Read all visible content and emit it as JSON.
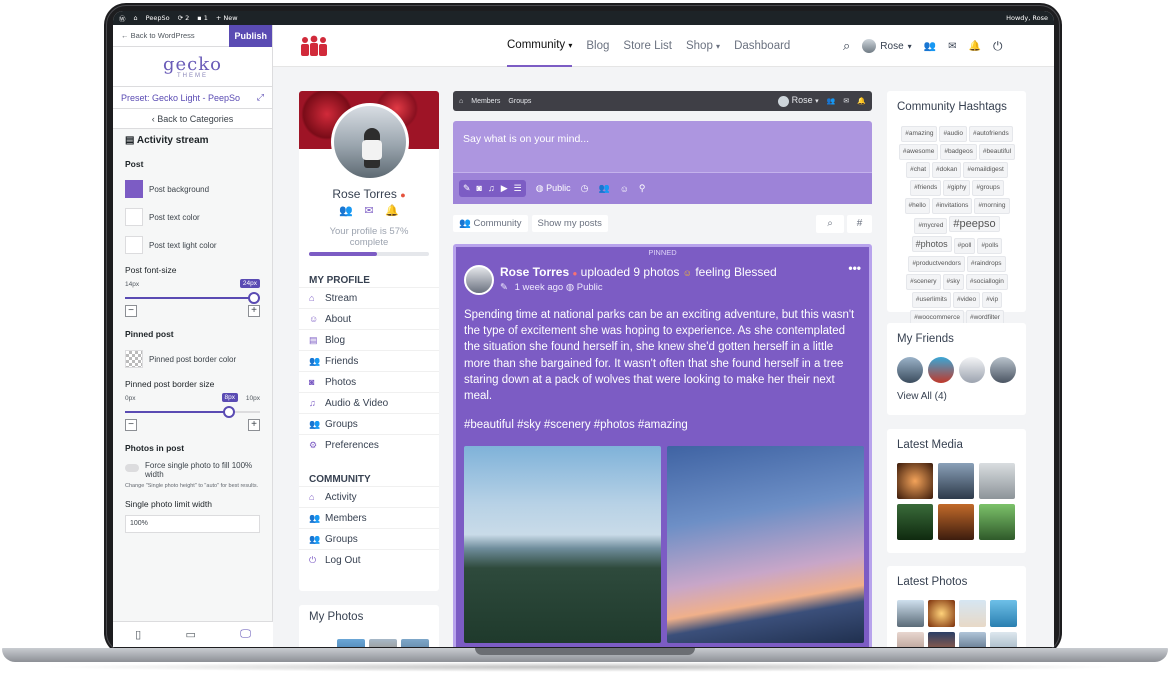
{
  "admin_bar": {
    "site": "PeepSo",
    "updates": "2",
    "comments": "1",
    "new": "New",
    "howdy": "Howdy, Rose"
  },
  "customizer": {
    "back": "Back to WordPress",
    "publish": "Publish",
    "logo_main": "gecko",
    "logo_sub": "THEME",
    "preset": "Preset: Gecko Light - PeepSo",
    "back_categories": "Back to Categories",
    "section": "Activity stream",
    "post_label": "Post",
    "post_background": "Post background",
    "post_text_color": "Post text color",
    "post_text_light_color": "Post text light color",
    "font_size_label": "Post font-size",
    "font_size_min": "14px",
    "font_size_value": "24px",
    "font_size_fraction": 1.0,
    "pinned_label": "Pinned post",
    "pinned_border_color": "Pinned post border color",
    "pinned_border_size": "Pinned post border size",
    "border_min": "0px",
    "border_value": "8px",
    "border_max": "10px",
    "border_fraction": 0.8,
    "photos_label": "Photos in post",
    "force_single": "Force single photo to fill 100% width",
    "hint": "Change \"Single photo height\" to \"auto\" for best results.",
    "single_limit": "Single photo limit width",
    "single_limit_value": "100%",
    "colors": {
      "post_background": "#7c5cc4"
    }
  },
  "nav": {
    "items": [
      "Community",
      "Blog",
      "Store List",
      "Shop",
      "Dashboard"
    ],
    "user": "Rose"
  },
  "profile": {
    "name": "Rose Torres",
    "completion_text": "Your profile is 57% complete",
    "completion": 0.57,
    "my_profile_heading": "MY PROFILE",
    "my_profile": [
      "Stream",
      "About",
      "Blog",
      "Friends",
      "Photos",
      "Audio & Video",
      "Groups",
      "Preferences"
    ],
    "community_heading": "COMMUNITY",
    "community": [
      "Activity",
      "Members",
      "Groups",
      "Log Out"
    ],
    "my_photos": "My Photos"
  },
  "stream": {
    "topbar": [
      "Members",
      "Groups"
    ],
    "topbar_user": "Rose",
    "composer_placeholder": "Say what is on your mind...",
    "privacy": "Public",
    "tabs": [
      "Community",
      "Show my posts"
    ],
    "pinned": "PINNED",
    "post": {
      "author": "Rose Torres",
      "action": "uploaded 9 photos",
      "feeling": "feeling Blessed",
      "time": "1 week ago",
      "privacy": "Public",
      "body": "Spending time at national parks can be an exciting adventure, but this wasn't the type of excitement she was hoping to experience. As she contemplated the situation she found herself in, she knew she'd gotten herself in a little more than she bargained for. It wasn't often that she found herself in a tree staring down at a pack of wolves that were looking to make her their next meal.",
      "hashtags": "#beautiful #sky #scenery #photos #amazing"
    }
  },
  "hashtags": {
    "title": "Community Hashtags",
    "tags": [
      "#amazing",
      "#audio",
      "#autofriends",
      "#awesome",
      "#badgeos",
      "#beautiful",
      "#chat",
      "#dokan",
      "#emaildigest",
      "#friends",
      "#giphy",
      "#groups",
      "#hello",
      "#invitations",
      "#morning",
      "#mycred",
      "#peepso",
      "#photos",
      "#poll",
      "#polls",
      "#productvendors",
      "#raindrops",
      "#scenery",
      "#sky",
      "#sociallogin",
      "#userlimits",
      "#video",
      "#vip",
      "#woocommerce",
      "#wordfilter"
    ]
  },
  "friends": {
    "title": "My Friends",
    "view_all": "View All (4)"
  },
  "latest_media": {
    "title": "Latest Media"
  },
  "latest_photos": {
    "title": "Latest Photos"
  }
}
